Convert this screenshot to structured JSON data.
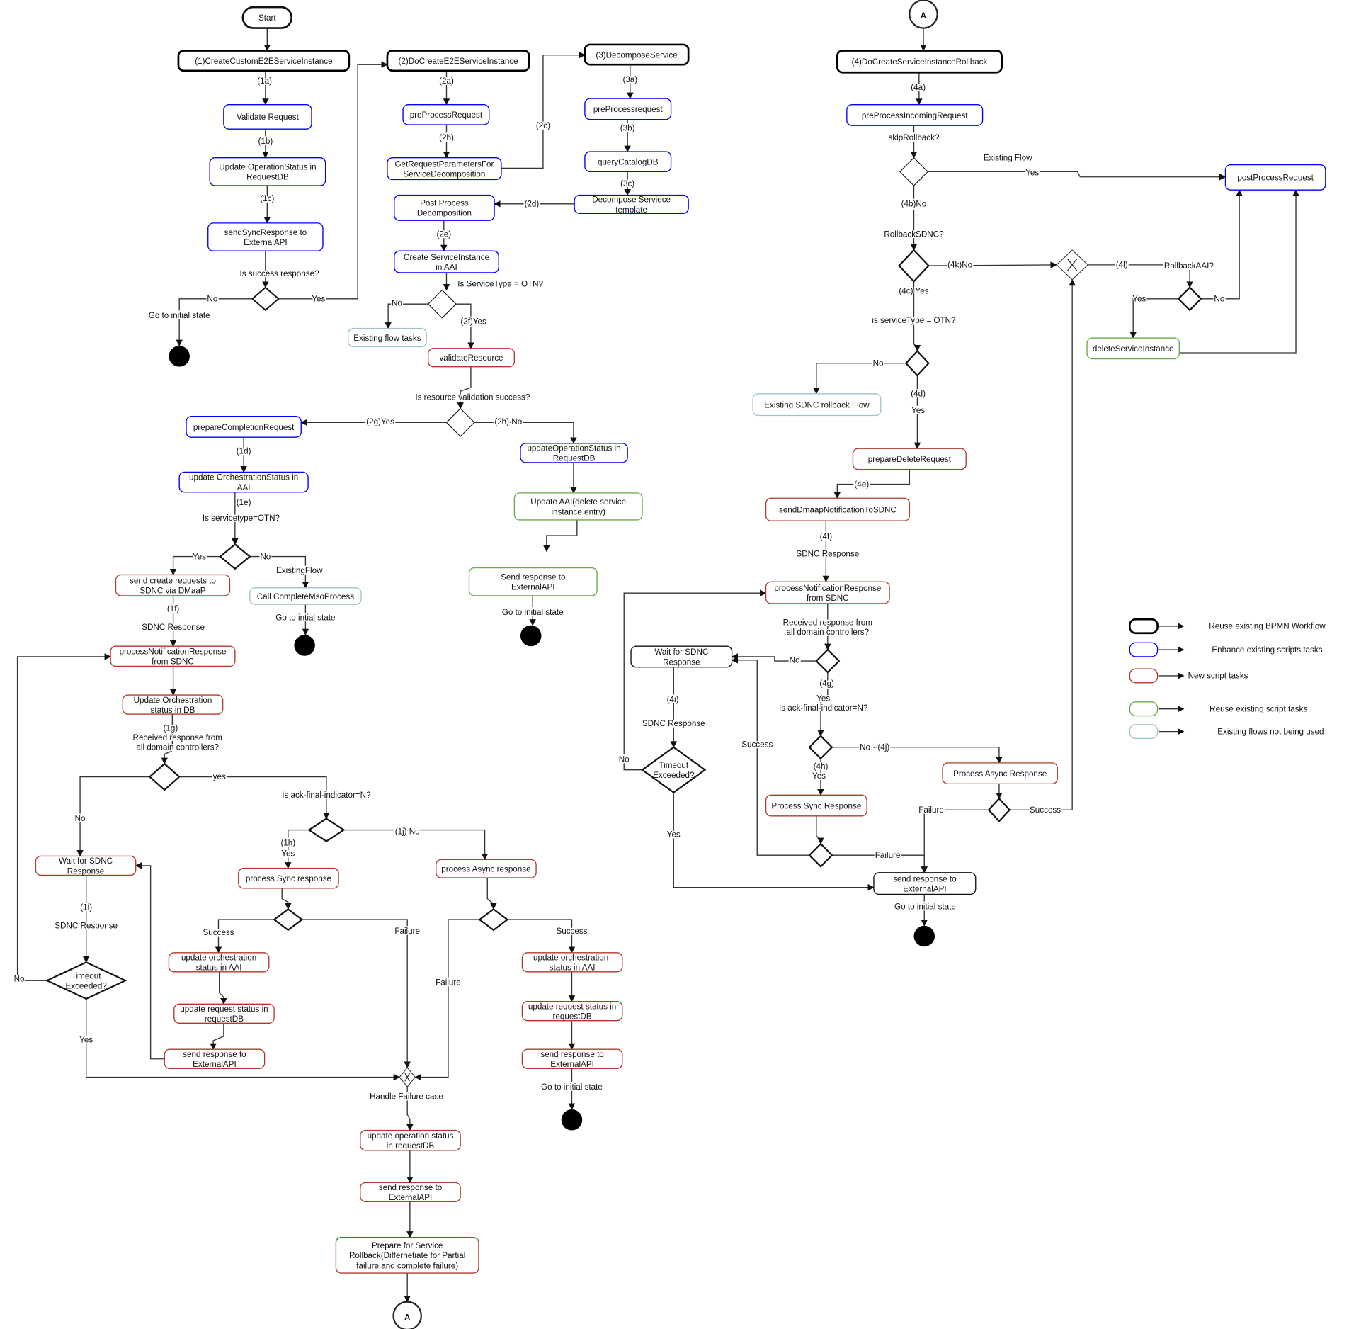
{
  "colors": {
    "workflow": "#000000",
    "enhance": "#0000ff",
    "new": "#b03a2e",
    "reuse_script": "#6aaa4a",
    "unused": "#9ec3c8"
  },
  "nodes": [
    {
      "id": "start",
      "kind": "terminal",
      "lines": [
        "Start"
      ]
    },
    {
      "id": "n1",
      "kind": "workflow",
      "lines": [
        "(1)CreateCustomE2EServiceInstance"
      ]
    },
    {
      "id": "n1a",
      "kind": "enhance",
      "lines": [
        "Validate Request"
      ]
    },
    {
      "id": "n1b",
      "kind": "enhance",
      "lines": [
        "Update OperationStatus in",
        "RequestDB"
      ]
    },
    {
      "id": "n1c",
      "kind": "enhance",
      "lines": [
        "sendSyncResponse to",
        "ExternalAPI"
      ]
    },
    {
      "id": "n2",
      "kind": "workflow",
      "lines": [
        "(2)DoCreateE2EServiceInstance"
      ]
    },
    {
      "id": "n2a",
      "kind": "enhance",
      "lines": [
        "preProcessRequest"
      ]
    },
    {
      "id": "n2b",
      "kind": "enhance",
      "lines": [
        "GetRequestParametersFor",
        "ServiceDecomposition"
      ]
    },
    {
      "id": "n3",
      "kind": "workflow",
      "lines": [
        "(3)DecomposeService"
      ]
    },
    {
      "id": "n3a",
      "kind": "enhance",
      "lines": [
        "preProcessrequest"
      ]
    },
    {
      "id": "n3b",
      "kind": "enhance",
      "lines": [
        "queryCatalogDB"
      ]
    },
    {
      "id": "n3c",
      "kind": "enhance",
      "lines": [
        "Decompose Serviece",
        "template"
      ]
    },
    {
      "id": "n2d",
      "kind": "enhance",
      "lines": [
        "Post Process",
        "Decomposition"
      ]
    },
    {
      "id": "n2e",
      "kind": "enhance",
      "lines": [
        "Create ServiceInstance",
        "in AAI"
      ]
    },
    {
      "id": "nT1",
      "kind": "unused",
      "lines": [
        "Existing flow tasks"
      ]
    },
    {
      "id": "n2f",
      "kind": "new",
      "lines": [
        "validateResource"
      ]
    },
    {
      "id": "n2g",
      "kind": "enhance",
      "lines": [
        "prepareCompletionRequest"
      ]
    },
    {
      "id": "n2h",
      "kind": "enhance",
      "lines": [
        "updateOperationStatus in",
        "RequestDB"
      ]
    },
    {
      "id": "nG1",
      "kind": "reuse_script",
      "lines": [
        "Update AAI(delete service",
        "instance entry)"
      ]
    },
    {
      "id": "nG2",
      "kind": "reuse_script",
      "lines": [
        "Send response to",
        "ExternalAPI"
      ]
    },
    {
      "id": "n1d",
      "kind": "enhance",
      "lines": [
        "update OrchestrationStatus in",
        "AAI"
      ]
    },
    {
      "id": "nR1",
      "kind": "new",
      "lines": [
        "send create requests to",
        "SDNC via DMaaP"
      ]
    },
    {
      "id": "nT2",
      "kind": "unused",
      "lines": [
        "Call CompleteMsoProcess"
      ]
    },
    {
      "id": "nR2",
      "kind": "new",
      "lines": [
        "processNotificationResponse",
        "from SDNC"
      ]
    },
    {
      "id": "nR3",
      "kind": "new",
      "lines": [
        "Update Orchestration",
        "status in DB"
      ]
    },
    {
      "id": "nR4",
      "kind": "new",
      "lines": [
        "Wait for SDNC",
        "Response"
      ]
    },
    {
      "id": "nR5",
      "kind": "new",
      "lines": [
        "process Sync response"
      ]
    },
    {
      "id": "nR6",
      "kind": "new",
      "lines": [
        "process Async response"
      ]
    },
    {
      "id": "nR7",
      "kind": "new",
      "lines": [
        "update orchestration",
        "status in AAI"
      ]
    },
    {
      "id": "nR8",
      "kind": "new",
      "lines": [
        "update request status in",
        "requestDB"
      ]
    },
    {
      "id": "nR9",
      "kind": "new",
      "lines": [
        "send response to",
        "ExternalAPI"
      ]
    },
    {
      "id": "nR10",
      "kind": "new",
      "lines": [
        "update orchestration-",
        "status in AAI"
      ]
    },
    {
      "id": "nR11",
      "kind": "new",
      "lines": [
        "update request status in",
        "requestDB"
      ]
    },
    {
      "id": "nR12",
      "kind": "new",
      "lines": [
        "send response to",
        "ExternalAPI"
      ]
    },
    {
      "id": "nR13",
      "kind": "new",
      "lines": [
        "update operation status",
        "in requestDB"
      ]
    },
    {
      "id": "nR14",
      "kind": "new",
      "lines": [
        "send response to",
        "ExternalAPI"
      ]
    },
    {
      "id": "nR15",
      "kind": "new",
      "lines": [
        "Prepare for Service",
        "Rollback(Differnetiate for Partial",
        "failure and complete failure)"
      ]
    },
    {
      "id": "n4",
      "kind": "workflow",
      "lines": [
        "(4)DoCreateServiceInstanceRollback"
      ]
    },
    {
      "id": "n4a",
      "kind": "enhance",
      "lines": [
        "preProcessIncomingRequest"
      ]
    },
    {
      "id": "nPost",
      "kind": "enhance",
      "lines": [
        "postProcessRequest"
      ]
    },
    {
      "id": "nG3",
      "kind": "reuse_script",
      "lines": [
        "deleteServiceInstance"
      ]
    },
    {
      "id": "nT3",
      "kind": "unused",
      "lines": [
        "Existing SDNC rollback Flow"
      ]
    },
    {
      "id": "nR20",
      "kind": "new",
      "lines": [
        "prepareDeleteRequest"
      ]
    },
    {
      "id": "nR21",
      "kind": "new",
      "lines": [
        "sendDmaapNotificationToSDNC"
      ]
    },
    {
      "id": "nR22",
      "kind": "new",
      "lines": [
        "processNotificationResponse",
        "from SDNC"
      ]
    },
    {
      "id": "nB1",
      "kind": "plain",
      "lines": [
        "Wait for SDNC",
        "Response"
      ]
    },
    {
      "id": "nR23",
      "kind": "new",
      "lines": [
        "Process Async Response"
      ]
    },
    {
      "id": "nR24",
      "kind": "new",
      "lines": [
        "Process Sync Response"
      ]
    },
    {
      "id": "nB2",
      "kind": "plain",
      "lines": [
        "send response to",
        "ExternalAPI"
      ]
    },
    {
      "id": "d6",
      "kind": "decision",
      "lines": [
        "Timeout",
        "Exceeded?"
      ]
    },
    {
      "id": "d15",
      "kind": "decision",
      "lines": [
        "Timeout",
        "Exceeded?"
      ]
    },
    {
      "id": "cA1",
      "kind": "connector",
      "lines": [
        "A"
      ]
    },
    {
      "id": "cA2",
      "kind": "connector",
      "lines": [
        "A"
      ]
    }
  ],
  "edge_labels": [
    "(1a)",
    "(1b)",
    "(1c)",
    "Is success response?",
    "No",
    "Yes",
    "Go to initial state",
    "(2a)",
    "(2b)",
    "(2c)",
    "(3a)",
    "(3b)",
    "(3c)",
    "(2d)",
    "(2e)",
    "Is ServiceType = OTN?",
    "No",
    "(2f)Yes",
    "Is resource validation success?",
    "(2g)Yes",
    "(2h) No",
    "(1d)",
    "(1e)",
    "Is servicetype=OTN?",
    "Yes",
    "No",
    "ExistingFlow",
    "Go to intial state",
    "Go to initial state",
    "(1f)",
    "SDNC Response",
    "(1g)",
    "Received response from",
    "all domain controllers?",
    "yes",
    "No",
    "Is ack-final-indicator=N?",
    "(1h)",
    "Yes",
    "(1j) No",
    "(1i)",
    "SDNC Response",
    "No",
    "Yes",
    "Success",
    "Failure",
    "Failure",
    "Success",
    "Handle Failure case",
    "Go to initial state",
    "(4a)",
    "skipRollback?",
    "Existing Flow",
    "Yes",
    "(4b)No",
    "RollbackSDNC?",
    "(4k)No",
    "(4c) Yes",
    "(4l)",
    "RollbackAAI?",
    "Yes",
    "No",
    "is serviceType = OTN?",
    "No",
    "(4d)",
    "Yes",
    "(4e)",
    "(4f)",
    "SDNC Response",
    "Received response from",
    "all domain controllers?",
    "No",
    "(4g)",
    "Yes",
    "Is ack-final-indicator=N?",
    "(4i)",
    "SDNC Response",
    "Success",
    "No",
    "No · (4j)",
    "(4h)",
    "Yes",
    "Yes",
    "Failure",
    "Success",
    "Failure",
    "Go to initial state"
  ],
  "legend": [
    {
      "kind": "workflow",
      "label": "Reuse existing BPMN Workflow"
    },
    {
      "kind": "enhance",
      "label": "Enhance existing scripts tasks"
    },
    {
      "kind": "new",
      "label": "New script tasks"
    },
    {
      "kind": "reuse_script",
      "label": "Reuse existing script tasks"
    },
    {
      "kind": "unused",
      "label": "Existing flows not being used"
    }
  ]
}
